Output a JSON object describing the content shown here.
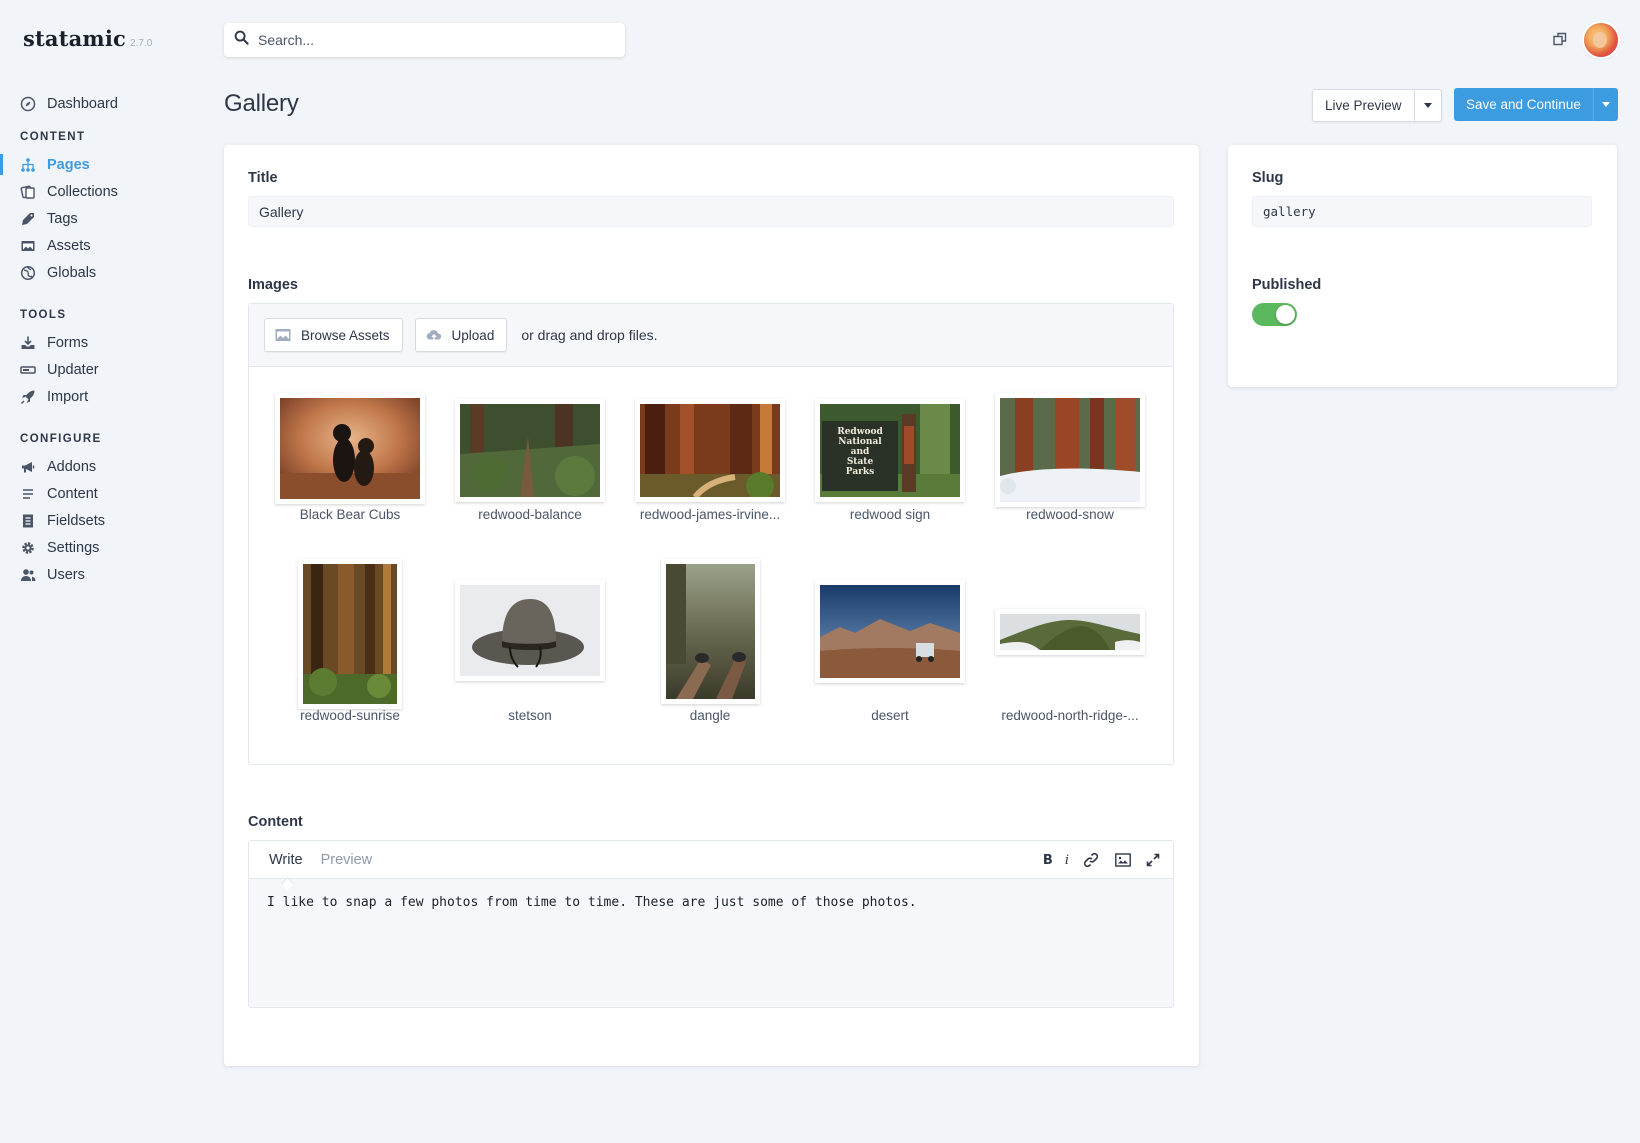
{
  "app": {
    "name": "statamic",
    "version": "2.7.0"
  },
  "search": {
    "placeholder": "Search..."
  },
  "icons": {
    "popout": "external-window-icon",
    "avatar": "user-avatar"
  },
  "sidebar": {
    "dashboard": {
      "label": "Dashboard",
      "icon": "compass-icon"
    },
    "sections": [
      {
        "title": "CONTENT",
        "items": [
          {
            "label": "Pages",
            "icon": "sitemap-icon",
            "active": true
          },
          {
            "label": "Collections",
            "icon": "collections-icon"
          },
          {
            "label": "Tags",
            "icon": "tag-icon"
          },
          {
            "label": "Assets",
            "icon": "image-icon"
          },
          {
            "label": "Globals",
            "icon": "globe-icon"
          }
        ]
      },
      {
        "title": "TOOLS",
        "items": [
          {
            "label": "Forms",
            "icon": "inbox-icon"
          },
          {
            "label": "Updater",
            "icon": "updater-icon"
          },
          {
            "label": "Import",
            "icon": "rocket-icon"
          }
        ]
      },
      {
        "title": "CONFIGURE",
        "items": [
          {
            "label": "Addons",
            "icon": "megaphone-icon"
          },
          {
            "label": "Content",
            "icon": "lines-icon"
          },
          {
            "label": "Fieldsets",
            "icon": "document-icon"
          },
          {
            "label": "Settings",
            "icon": "gear-icon"
          },
          {
            "label": "Users",
            "icon": "users-icon"
          }
        ]
      }
    ]
  },
  "header": {
    "title": "Gallery",
    "live_preview": "Live Preview",
    "save": "Save and Continue"
  },
  "form": {
    "title": {
      "label": "Title",
      "value": "Gallery"
    },
    "images": {
      "label": "Images",
      "browse": "Browse Assets",
      "upload": "Upload",
      "drag_text": "or drag and drop files.",
      "assets": [
        {
          "name": "Black Bear Cubs",
          "shape": "landscape"
        },
        {
          "name": "redwood-balance",
          "shape": "landscape"
        },
        {
          "name": "redwood-james-irvine...",
          "shape": "landscape"
        },
        {
          "name": "redwood sign",
          "shape": "landscape",
          "sign_text": "Redwood National and State Parks"
        },
        {
          "name": "redwood-snow",
          "shape": "landscape-tall"
        },
        {
          "name": "redwood-sunrise",
          "shape": "portrait"
        },
        {
          "name": "stetson",
          "shape": "landscape"
        },
        {
          "name": "dangle",
          "shape": "portrait"
        },
        {
          "name": "desert",
          "shape": "landscape"
        },
        {
          "name": "redwood-north-ridge-...",
          "shape": "panorama"
        }
      ]
    },
    "content": {
      "label": "Content",
      "tab_write": "Write",
      "tab_preview": "Preview",
      "tool_bold": "B",
      "tool_italic": "i",
      "body": "I like to snap a few photos from time to time. These are just some of those photos."
    }
  },
  "meta": {
    "slug": {
      "label": "Slug",
      "value": "gallery"
    },
    "published": {
      "label": "Published",
      "on": true
    }
  },
  "colors": {
    "accent": "#3d9ce0",
    "toggle_on": "#5cb85c",
    "background": "#f1f4f8"
  }
}
